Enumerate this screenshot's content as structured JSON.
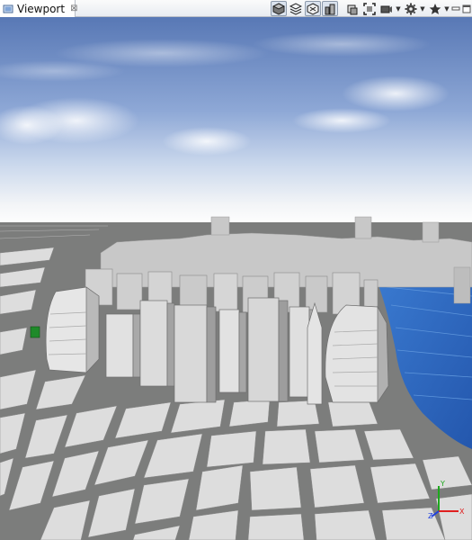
{
  "window": {
    "tab_label": "Viewport",
    "tab_close_glyph": "⊠"
  },
  "toolbar": {
    "buttons": [
      {
        "icon": "shaded-view-icon",
        "active": true
      },
      {
        "icon": "wireframe-view-icon",
        "active": false
      },
      {
        "icon": "texture-view-icon",
        "active": true
      },
      {
        "icon": "building-view-icon",
        "active": true
      },
      {
        "icon": "camera-bookmark-icon",
        "active": false
      },
      {
        "icon": "frame-selection-icon",
        "active": false
      },
      {
        "icon": "camera-icon",
        "active": false
      },
      {
        "icon": "gear-icon",
        "active": false
      },
      {
        "icon": "star-icon",
        "active": false
      }
    ],
    "minimize_glyph": "▭",
    "maximize_glyph": "▭"
  },
  "gizmo": {
    "x_label": "X",
    "y_label": "Y",
    "z_label": "Z",
    "colors": {
      "x": "#e02020",
      "y": "#1ea81e",
      "z": "#1f3fe0"
    }
  },
  "scene": {
    "sky_top": "#5577b8",
    "sky_horizon": "#f4f6f8",
    "ground": "#7e7f7e",
    "block": "#dcdcdc",
    "water": "#2e6bc4",
    "building": "#cfcfcf"
  }
}
